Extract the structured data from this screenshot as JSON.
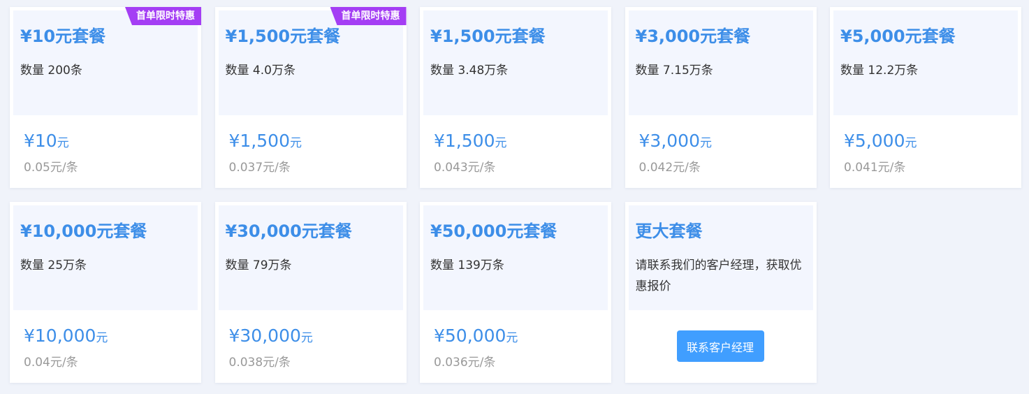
{
  "packages": [
    {
      "title": "¥10元套餐",
      "qty": "数量 200条",
      "price": "¥10",
      "unit": "元",
      "rate": "0.05元/条",
      "badge": "首单限时特惠"
    },
    {
      "title": "¥1,500元套餐",
      "qty": "数量 4.0万条",
      "price": "¥1,500",
      "unit": "元",
      "rate": "0.037元/条",
      "badge": "首单限时特惠"
    },
    {
      "title": "¥1,500元套餐",
      "qty": "数量 3.48万条",
      "price": "¥1,500",
      "unit": "元",
      "rate": "0.043元/条"
    },
    {
      "title": "¥3,000元套餐",
      "qty": "数量 7.15万条",
      "price": "¥3,000",
      "unit": "元",
      "rate": "0.042元/条"
    },
    {
      "title": "¥5,000元套餐",
      "qty": "数量 12.2万条",
      "price": "¥5,000",
      "unit": "元",
      "rate": "0.041元/条"
    },
    {
      "title": "¥10,000元套餐",
      "qty": "数量 25万条",
      "price": "¥10,000",
      "unit": "元",
      "rate": "0.04元/条"
    },
    {
      "title": "¥30,000元套餐",
      "qty": "数量 79万条",
      "price": "¥30,000",
      "unit": "元",
      "rate": "0.038元/条"
    },
    {
      "title": "¥50,000元套餐",
      "qty": "数量 139万条",
      "price": "¥50,000",
      "unit": "元",
      "rate": "0.036元/条"
    }
  ],
  "custom": {
    "title": "更大套餐",
    "description": "请联系我们的客户经理，获取优惠报价",
    "button_label": "联系客户经理"
  },
  "colors": {
    "accent": "#3d8ee8",
    "button": "#409eff",
    "badge": "#a43ef4",
    "background": "#f0f3fa"
  }
}
